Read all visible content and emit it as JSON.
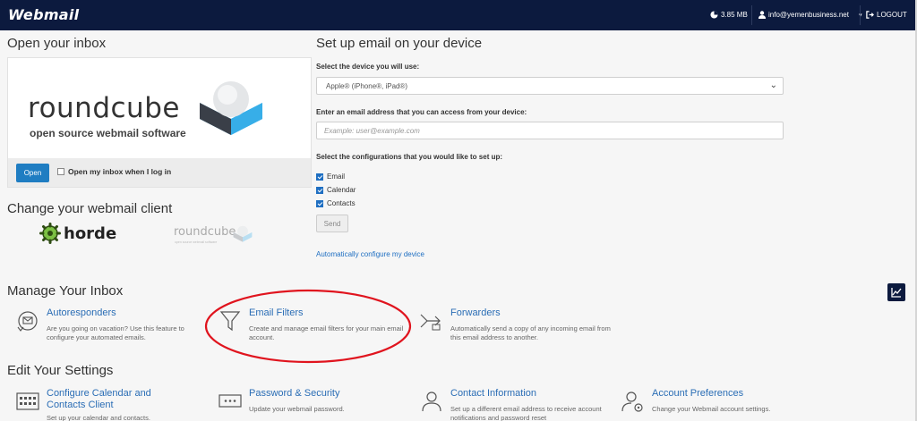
{
  "header": {
    "logo": "Webmail",
    "disk_usage": "3.85 MB",
    "user": "info@yemenbusiness.net",
    "logout": "LOGOUT"
  },
  "open_inbox": {
    "title": "Open your inbox",
    "roundcube_logo_text": "roundcube",
    "roundcube_tagline": "open source webmail software",
    "open_button": "Open",
    "checkbox_label": "Open my inbox when I log in"
  },
  "change_client": {
    "title": "Change your webmail client",
    "clients": [
      "horde",
      "roundcube"
    ],
    "roundcube_small_tagline": "open source webmail software"
  },
  "setup_device": {
    "title": "Set up email on your device",
    "device_label": "Select the device you will use:",
    "device_value": "Apple® (iPhone®, iPad®)",
    "email_label": "Enter an email address that you can access from your device:",
    "email_placeholder": "Example: user@example.com",
    "config_label": "Select the configurations that you would like to set up:",
    "options": [
      "Email",
      "Calendar",
      "Contacts"
    ],
    "send_button": "Send",
    "auto_link": "Automatically configure my device"
  },
  "manage_inbox": {
    "title": "Manage Your Inbox",
    "items": [
      {
        "title": "Autoresponders",
        "desc": "Are you going on vacation? Use this feature to configure your automated emails.",
        "icon": "autoresponder-icon"
      },
      {
        "title": "Email Filters",
        "desc": "Create and manage email filters for your main email account.",
        "icon": "filter-icon"
      },
      {
        "title": "Forwarders",
        "desc": "Automatically send a copy of any incoming email from this email address to another.",
        "icon": "forward-icon"
      }
    ]
  },
  "edit_settings": {
    "title": "Edit Your Settings",
    "items": [
      {
        "title": "Configure Calendar and Contacts Client",
        "desc": "Set up your calendar and contacts.",
        "icon": "calendar-icon"
      },
      {
        "title": "Password & Security",
        "desc": "Update your webmail password.",
        "icon": "password-icon"
      },
      {
        "title": "Contact Information",
        "desc": "Set up a different email address to receive account notifications and password reset",
        "icon": "contact-icon"
      },
      {
        "title": "Account Preferences",
        "desc": "Change your Webmail account settings.",
        "icon": "preferences-icon"
      }
    ]
  },
  "colors": {
    "header_bg": "#0c1a3e",
    "link": "#2a6db5",
    "primary_button": "#1f7dc2",
    "annotation_circle": "#e0141e"
  }
}
